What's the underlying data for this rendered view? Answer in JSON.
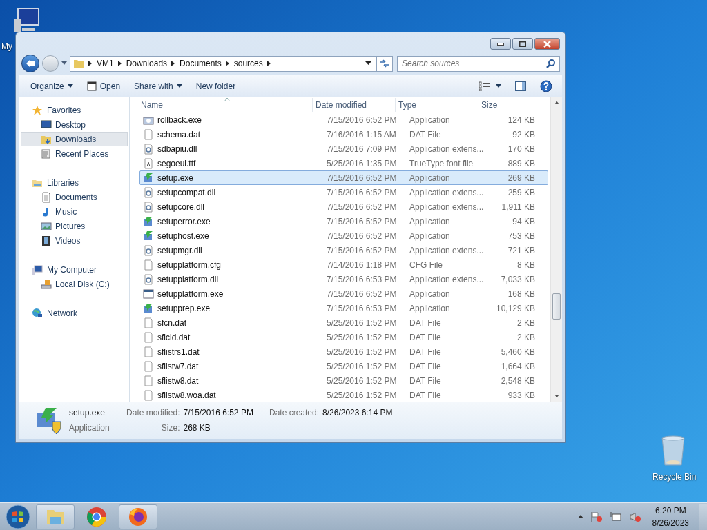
{
  "desktop": {
    "icons": [
      {
        "label": "My",
        "kind": "computer"
      },
      {
        "label": "Recycle Bin",
        "kind": "bin"
      }
    ]
  },
  "address": {
    "crumbs": [
      "VM1",
      "Downloads",
      "Documents",
      "sources"
    ],
    "search_placeholder": "Search sources"
  },
  "toolbar": {
    "items": [
      {
        "label": "Organize",
        "dropdown": true,
        "icon": false
      },
      {
        "label": "Open",
        "dropdown": false,
        "icon": true
      },
      {
        "label": "Share with",
        "dropdown": true,
        "icon": false
      },
      {
        "label": "New folder",
        "dropdown": false,
        "icon": false
      }
    ]
  },
  "nav": {
    "groups": [
      {
        "label": "Favorites",
        "kind": "star",
        "children": [
          {
            "label": "Desktop",
            "kind": "desktop",
            "selected": false
          },
          {
            "label": "Downloads",
            "kind": "downloads",
            "selected": true
          },
          {
            "label": "Recent Places",
            "kind": "recent",
            "selected": false
          }
        ]
      },
      {
        "label": "Libraries",
        "kind": "libraries",
        "children": [
          {
            "label": "Documents",
            "kind": "doc",
            "selected": false
          },
          {
            "label": "Music",
            "kind": "music",
            "selected": false
          },
          {
            "label": "Pictures",
            "kind": "pictures",
            "selected": false
          },
          {
            "label": "Videos",
            "kind": "videos",
            "selected": false
          }
        ]
      },
      {
        "label": "My Computer",
        "kind": "computer",
        "children": [
          {
            "label": "Local Disk (C:)",
            "kind": "disk",
            "selected": false
          }
        ]
      },
      {
        "label": "Network",
        "kind": "network"
      }
    ]
  },
  "table": {
    "columns": [
      "Name",
      "Date modified",
      "Type",
      "Size"
    ],
    "rows": [
      {
        "name": "rollback.exe",
        "date": "7/15/2016 6:52 PM",
        "type": "Application",
        "size": "124 KB",
        "kind": "rollback",
        "selected": false
      },
      {
        "name": "schema.dat",
        "date": "7/16/2016 1:15 AM",
        "type": "DAT File",
        "size": "92 KB",
        "kind": "file",
        "selected": false
      },
      {
        "name": "sdbapiu.dll",
        "date": "7/15/2016 7:09 PM",
        "type": "Application extens...",
        "size": "170 KB",
        "kind": "dll",
        "selected": false
      },
      {
        "name": "segoeui.ttf",
        "date": "5/25/2016 1:35 PM",
        "type": "TrueType font file",
        "size": "889 KB",
        "kind": "font",
        "selected": false
      },
      {
        "name": "setup.exe",
        "date": "7/15/2016 6:52 PM",
        "type": "Application",
        "size": "269 KB",
        "kind": "setup",
        "selected": true
      },
      {
        "name": "setupcompat.dll",
        "date": "7/15/2016 6:52 PM",
        "type": "Application extens...",
        "size": "259 KB",
        "kind": "dll",
        "selected": false
      },
      {
        "name": "setupcore.dll",
        "date": "7/15/2016 6:52 PM",
        "type": "Application extens...",
        "size": "1,911 KB",
        "kind": "dll",
        "selected": false
      },
      {
        "name": "setuperror.exe",
        "date": "7/15/2016 5:52 PM",
        "type": "Application",
        "size": "94 KB",
        "kind": "setup",
        "selected": false
      },
      {
        "name": "setuphost.exe",
        "date": "7/15/2016 6:52 PM",
        "type": "Application",
        "size": "753 KB",
        "kind": "setup",
        "selected": false
      },
      {
        "name": "setupmgr.dll",
        "date": "7/15/2016 6:52 PM",
        "type": "Application extens...",
        "size": "721 KB",
        "kind": "dll",
        "selected": false
      },
      {
        "name": "setupplatform.cfg",
        "date": "7/14/2016 1:18 PM",
        "type": "CFG File",
        "size": "8 KB",
        "kind": "file",
        "selected": false
      },
      {
        "name": "setupplatform.dll",
        "date": "7/15/2016 6:53 PM",
        "type": "Application extens...",
        "size": "7,033 KB",
        "kind": "dll",
        "selected": false
      },
      {
        "name": "setupplatform.exe",
        "date": "7/15/2016 6:52 PM",
        "type": "Application",
        "size": "168 KB",
        "kind": "app",
        "selected": false
      },
      {
        "name": "setupprep.exe",
        "date": "7/15/2016 6:53 PM",
        "type": "Application",
        "size": "10,129 KB",
        "kind": "setup",
        "selected": false
      },
      {
        "name": "sfcn.dat",
        "date": "5/25/2016 1:52 PM",
        "type": "DAT File",
        "size": "2 KB",
        "kind": "file",
        "selected": false
      },
      {
        "name": "sflcid.dat",
        "date": "5/25/2016 1:52 PM",
        "type": "DAT File",
        "size": "2 KB",
        "kind": "file",
        "selected": false
      },
      {
        "name": "sflistrs1.dat",
        "date": "5/25/2016 1:52 PM",
        "type": "DAT File",
        "size": "5,460 KB",
        "kind": "file",
        "selected": false
      },
      {
        "name": "sflistw7.dat",
        "date": "5/25/2016 1:52 PM",
        "type": "DAT File",
        "size": "1,664 KB",
        "kind": "file",
        "selected": false
      },
      {
        "name": "sflistw8.dat",
        "date": "5/25/2016 1:52 PM",
        "type": "DAT File",
        "size": "2,548 KB",
        "kind": "file",
        "selected": false
      },
      {
        "name": "sflistw8.woa.dat",
        "date": "5/25/2016 1:52 PM",
        "type": "DAT File",
        "size": "933 KB",
        "kind": "file",
        "selected": false
      }
    ]
  },
  "details": {
    "name": "setup.exe",
    "type": "Application",
    "modified_label": "Date modified:",
    "modified": "7/15/2016 6:52 PM",
    "created_label": "Date created:",
    "created": "8/26/2023 6:14 PM",
    "size_label": "Size:",
    "size": "268 KB"
  },
  "taskbar": {
    "apps": [
      {
        "kind": "explorer",
        "selected": true
      },
      {
        "kind": "chrome",
        "selected": false
      },
      {
        "kind": "firefox",
        "selected": true
      }
    ],
    "time": "6:20 PM",
    "date": "8/26/2023"
  }
}
